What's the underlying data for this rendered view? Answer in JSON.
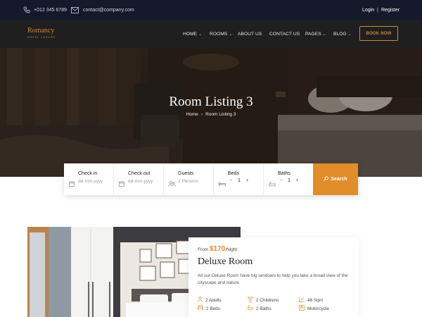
{
  "topbar": {
    "phone": "+012 345 6789",
    "email": "contact@company.com",
    "login": "Login",
    "separator": "|",
    "register": "Register"
  },
  "brand": {
    "name": "Romancy",
    "tagline": "HOTEL LUXURY",
    "accent": "#c8893a"
  },
  "nav": {
    "items": [
      {
        "label": "HOME",
        "dropdown": true
      },
      {
        "label": "ROOMS",
        "dropdown": true
      },
      {
        "label": "ABOUT US",
        "dropdown": false
      },
      {
        "label": "CONTACT US",
        "dropdown": false
      },
      {
        "label": "PAGES",
        "dropdown": true
      },
      {
        "label": "BLOG",
        "dropdown": true
      }
    ],
    "book_label": "BOOK NOW"
  },
  "hero": {
    "title": "Room Listing 3",
    "breadcrumb": [
      "Home",
      "Room Listing 3"
    ]
  },
  "search": {
    "checkin": {
      "label": "Check in",
      "placeholder": "dd-mm-yyyy"
    },
    "checkout": {
      "label": "Check out",
      "placeholder": "dd-mm-yyyy"
    },
    "guests": {
      "label": "Guests",
      "value": "2",
      "unit": "Persons"
    },
    "beds": {
      "label": "Beds",
      "value": "1"
    },
    "baths": {
      "label": "Baths",
      "value": "1"
    },
    "button": "Search",
    "button_color": "#e18d2a"
  },
  "room": {
    "price_prefix": "From",
    "price": "$170",
    "price_suffix": "/Night",
    "title": "Deluxe Room",
    "description": "All our Deluxe Room have big windows to help you take a broad view of the cityscape and nature.",
    "amenities": [
      {
        "icon": "adults-icon",
        "text": "2 Adults"
      },
      {
        "icon": "children-icon",
        "text": "2 Childrens"
      },
      {
        "icon": "area-icon",
        "text": "48 Sqm"
      },
      {
        "icon": "bed-icon",
        "text": "2 Beds"
      },
      {
        "icon": "bath-icon",
        "text": "2 Baths"
      },
      {
        "icon": "motorcycle-icon",
        "text": "Motorcycle"
      }
    ]
  }
}
